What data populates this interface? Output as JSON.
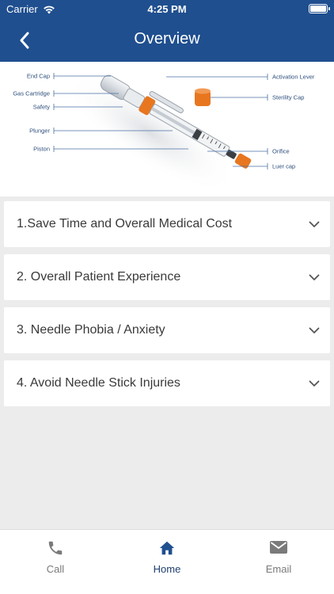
{
  "status_bar": {
    "carrier": "Carrier",
    "time": "4:25 PM"
  },
  "nav": {
    "title": "Overview",
    "back_icon": "chevron-left-icon"
  },
  "diagram": {
    "labels_left": [
      "End Cap",
      "Gas Cartridge",
      "Safety",
      "Plunger",
      "Piston"
    ],
    "labels_right": [
      "Activation Lever",
      "Sterility Cap",
      "Orifice",
      "Luer cap"
    ]
  },
  "sections": [
    {
      "label": "1.Save Time and Overall Medical Cost",
      "expanded": false
    },
    {
      "label": "2. Overall Patient Experience",
      "expanded": false
    },
    {
      "label": "3. Needle Phobia / Anxiety",
      "expanded": false
    },
    {
      "label": "4. Avoid Needle Stick Injuries",
      "expanded": false
    }
  ],
  "tabbar": {
    "tabs": [
      {
        "label": "Call",
        "icon": "phone-icon",
        "active": false
      },
      {
        "label": "Home",
        "icon": "home-icon",
        "active": true
      },
      {
        "label": "Email",
        "icon": "envelope-icon",
        "active": false
      }
    ]
  },
  "colors": {
    "primary": "#1f4f8f",
    "background": "#ececec",
    "accent": "#e8761f",
    "inactive": "#7a7a7a"
  }
}
